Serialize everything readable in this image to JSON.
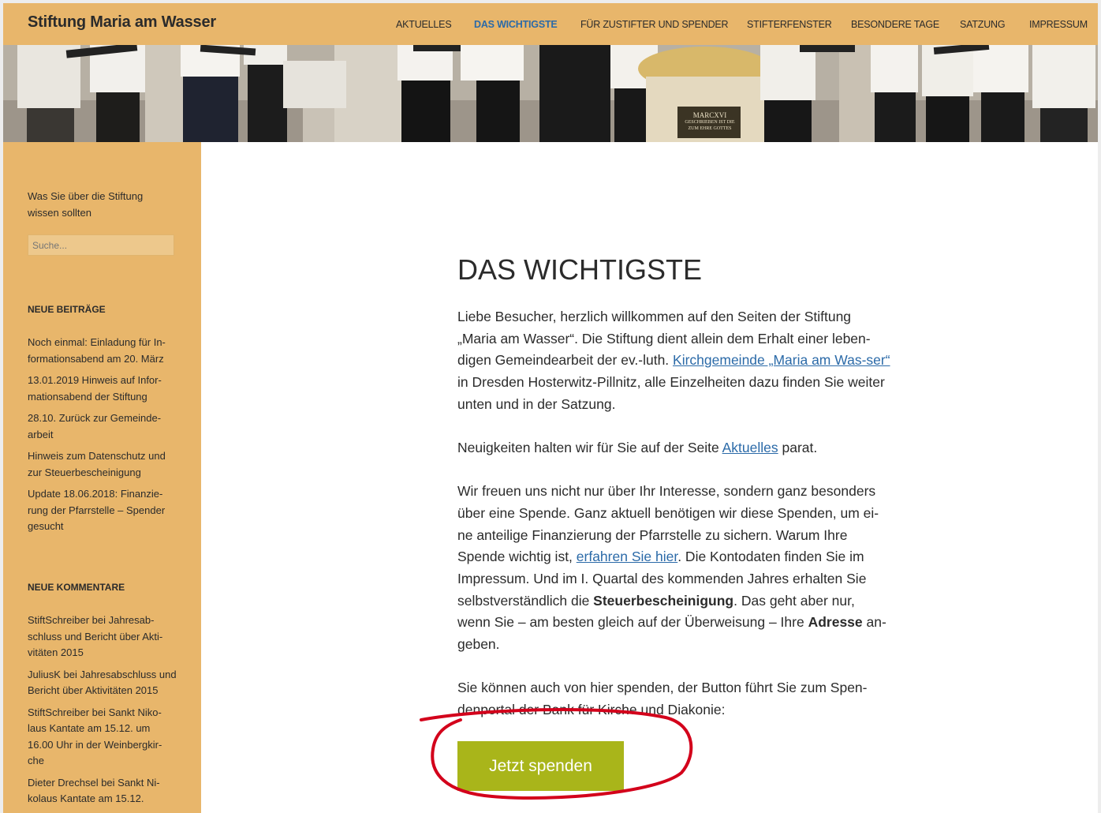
{
  "site": {
    "title": "Stiftung Maria am Wasser"
  },
  "nav": [
    {
      "label": "Aktuelles",
      "active": false
    },
    {
      "label": "Das Wichtigste",
      "active": true
    },
    {
      "label": "Für Zustifter und Spender",
      "active": false
    },
    {
      "label": "Stifterfenster",
      "active": false
    },
    {
      "label": "Besondere Tage",
      "active": false
    },
    {
      "label": "Satzung",
      "active": false
    },
    {
      "label": "Impressum",
      "active": false
    }
  ],
  "banner": {
    "plaque_line1": "MARCXVI",
    "plaque_line2": "GESCHRIEBEN IST DIE",
    "plaque_line3": "ZUM EHRE GOTTES"
  },
  "sidebar": {
    "description": "Was Sie über die Stiftung wissen sollten",
    "search_placeholder": "Suche...",
    "recent_posts_title": "Neue Beiträge",
    "recent_posts": [
      "Noch einmal: Einladung für In-formationsabend am 20. März",
      "13.01.2019 Hinweis auf Infor-mationsabend der Stiftung",
      "28.10. Zurück zur Gemeinde-arbeit",
      "Hinweis zum Datenschutz und zur Steuerbescheinigung",
      "Update 18.06.2018: Finanzie-rung der Pfarrstelle – Spender gesucht"
    ],
    "recent_comments_title": "Neue Kommentare",
    "recent_comments": [
      "StiftSchreiber bei Jahresab-schluss und Bericht über Akti-vitäten 2015",
      "JuliusK bei Jahresabschluss und Bericht über Aktivitäten 2015",
      "StiftSchreiber bei Sankt Niko-laus Kantate am 15.12. um 16.00 Uhr in der Weinbergkir-che",
      "Dieter Drechsel bei Sankt Ni-kolaus Kantate am 15.12."
    ]
  },
  "main": {
    "title": "DAS WICHTIGSTE",
    "p1_a": "Liebe Besucher, herzlich willkommen auf den Seiten der Stiftung „Maria am Wasser“. Die Stiftung dient allein dem Erhalt einer leben-digen Gemeindearbeit der ev.-luth. ",
    "p1_link": "Kirchgemeinde „Maria am Was-ser“",
    "p1_b": " in Dresden Hosterwitz-Pillnitz, alle Einzelheiten dazu finden Sie weiter unten und in der Satzung.",
    "p2_a": "Neuigkeiten halten wir für Sie auf der Seite ",
    "p2_link": "Aktuelles",
    "p2_b": " parat.",
    "p3_a": "Wir freuen uns nicht nur über Ihr Interesse, sondern ganz besonders über eine Spende. Ganz aktuell benötigen wir diese Spenden, um ei-ne anteilige Finanzierung der Pfarrstelle zu sichern. Warum Ihre Spende wichtig ist, ",
    "p3_link": "erfahren Sie hier",
    "p3_b": ". Die Kontodaten finden Sie im Impressum. Und im I. Quartal des kommenden Jahres erhalten Sie selbstverständlich die ",
    "p3_strong1": "Steuerbescheinigung",
    "p3_c": ". Das geht aber nur, wenn Sie – am besten gleich auf der Überweisung – Ihre ",
    "p3_strong2": "Adresse",
    "p3_d": " an-geben.",
    "p4": "Sie können auch von hier spenden, der Button führt Sie zum Spen-denportal der Bank für Kirche und Diakonie:",
    "donate_label": "Jetzt spenden"
  },
  "colors": {
    "header_bg": "#e8b66b",
    "link": "#2b6aa8",
    "donate_button": "#a9b51a",
    "annotation_circle": "#d3001b"
  }
}
